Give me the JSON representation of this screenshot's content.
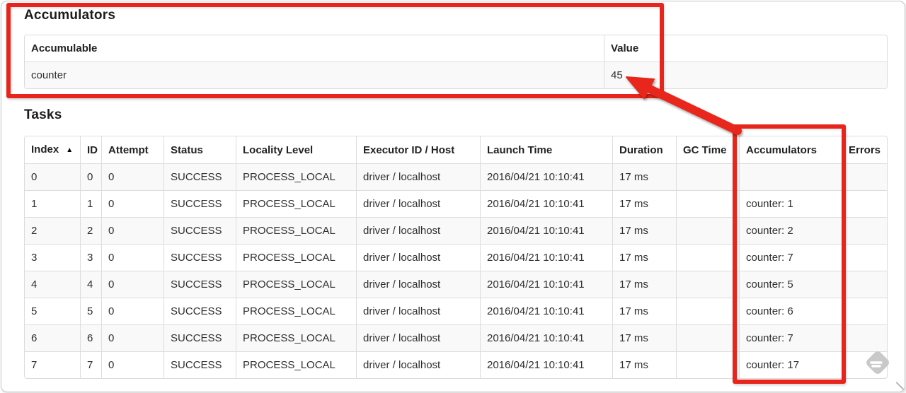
{
  "accumulators_section": {
    "title": "Accumulators",
    "table": {
      "columns": [
        "Accumulable",
        "Value"
      ],
      "rows": [
        [
          "counter",
          "45"
        ]
      ]
    }
  },
  "tasks_section": {
    "title": "Tasks",
    "table": {
      "columns": [
        "Index",
        "ID",
        "Attempt",
        "Status",
        "Locality Level",
        "Executor ID / Host",
        "Launch Time",
        "Duration",
        "GC Time",
        "Accumulators",
        "Errors"
      ],
      "sort_column": "Index",
      "sort_direction": "ascending",
      "sort_icon": "▲",
      "rows": [
        [
          "0",
          "0",
          "0",
          "SUCCESS",
          "PROCESS_LOCAL",
          "driver / localhost",
          "2016/04/21 10:10:41",
          "17 ms",
          "",
          "",
          ""
        ],
        [
          "1",
          "1",
          "0",
          "SUCCESS",
          "PROCESS_LOCAL",
          "driver / localhost",
          "2016/04/21 10:10:41",
          "17 ms",
          "",
          "counter: 1",
          ""
        ],
        [
          "2",
          "2",
          "0",
          "SUCCESS",
          "PROCESS_LOCAL",
          "driver / localhost",
          "2016/04/21 10:10:41",
          "17 ms",
          "",
          "counter: 2",
          ""
        ],
        [
          "3",
          "3",
          "0",
          "SUCCESS",
          "PROCESS_LOCAL",
          "driver / localhost",
          "2016/04/21 10:10:41",
          "17 ms",
          "",
          "counter: 7",
          ""
        ],
        [
          "4",
          "4",
          "0",
          "SUCCESS",
          "PROCESS_LOCAL",
          "driver / localhost",
          "2016/04/21 10:10:41",
          "17 ms",
          "",
          "counter: 5",
          ""
        ],
        [
          "5",
          "5",
          "0",
          "SUCCESS",
          "PROCESS_LOCAL",
          "driver / localhost",
          "2016/04/21 10:10:41",
          "17 ms",
          "",
          "counter: 6",
          ""
        ],
        [
          "6",
          "6",
          "0",
          "SUCCESS",
          "PROCESS_LOCAL",
          "driver / localhost",
          "2016/04/21 10:10:41",
          "17 ms",
          "",
          "counter: 7",
          ""
        ],
        [
          "7",
          "7",
          "0",
          "SUCCESS",
          "PROCESS_LOCAL",
          "driver / localhost",
          "2016/04/21 10:10:41",
          "17 ms",
          "",
          "counter: 17",
          ""
        ]
      ]
    }
  },
  "annotation": {
    "color": "#e8251c",
    "boxed_regions": [
      "accumulators-section",
      "tasks-accumulators-column"
    ],
    "arrow_points_at": "45"
  }
}
